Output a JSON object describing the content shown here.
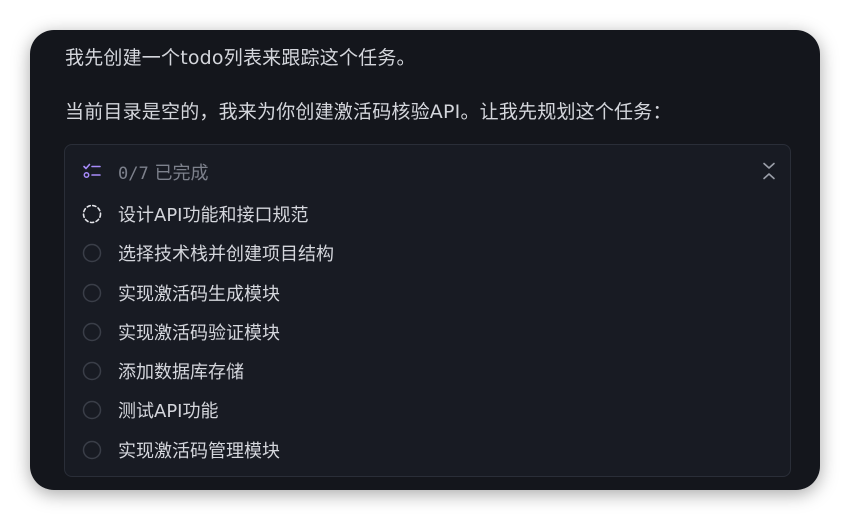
{
  "messages": [
    "我先创建一个todo列表来跟踪这个任务。",
    "当前目录是空的，我来为你创建激活码核验API。让我先规划这个任务："
  ],
  "todo": {
    "icon": "checklist-icon",
    "progress_count": "0/7",
    "progress_label": "已完成",
    "collapse_icon": "collapse-chevrons-icon",
    "items": [
      {
        "label": "设计API功能和接口规范",
        "status": "in_progress"
      },
      {
        "label": "选择技术栈并创建项目结构",
        "status": "pending"
      },
      {
        "label": "实现激活码生成模块",
        "status": "pending"
      },
      {
        "label": "实现激活码验证模块",
        "status": "pending"
      },
      {
        "label": "添加数据库存储",
        "status": "pending"
      },
      {
        "label": "测试API功能",
        "status": "pending"
      },
      {
        "label": "实现激活码管理模块",
        "status": "pending"
      }
    ]
  },
  "colors": {
    "background": "#14161c",
    "panel": "#181b23",
    "text": "#d4d6dc",
    "muted": "#7d818c",
    "accent": "#a78bfa"
  }
}
